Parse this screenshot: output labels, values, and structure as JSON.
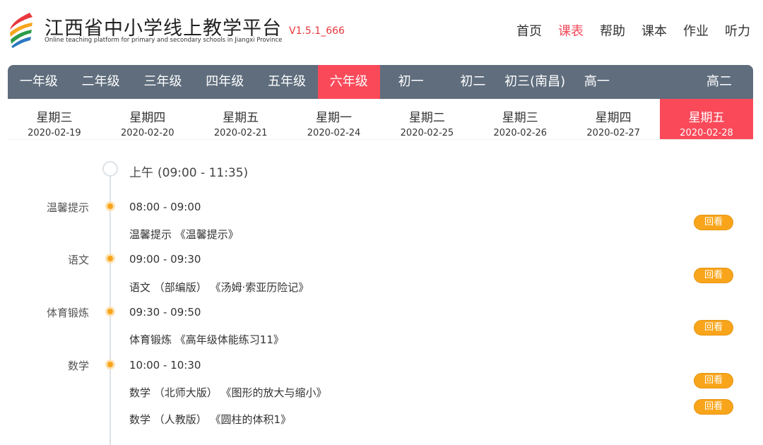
{
  "header": {
    "title": "江西省中小学线上教学平台",
    "subtitle": "Online teaching platform for primary and secondary schools in Jiangxi Province",
    "version": "V1.5.1_666",
    "nav": [
      "首页",
      "课表",
      "帮助",
      "课本",
      "作业",
      "听力"
    ],
    "active_nav": 1
  },
  "grades": [
    "一年级",
    "二年级",
    "三年级",
    "四年级",
    "五年级",
    "六年级",
    "初一",
    "初二",
    "初三(南昌)",
    "高一",
    "高二"
  ],
  "active_grade": 5,
  "days": [
    {
      "weekday": "星期三",
      "date": "2020-02-19"
    },
    {
      "weekday": "星期四",
      "date": "2020-02-20"
    },
    {
      "weekday": "星期五",
      "date": "2020-02-21"
    },
    {
      "weekday": "星期一",
      "date": "2020-02-24"
    },
    {
      "weekday": "星期二",
      "date": "2020-02-25"
    },
    {
      "weekday": "星期三",
      "date": "2020-02-26"
    },
    {
      "weekday": "星期四",
      "date": "2020-02-27"
    },
    {
      "weekday": "星期五",
      "date": "2020-02-28"
    }
  ],
  "active_day": 7,
  "section": {
    "label": "上午",
    "time": "(09:00 - 11:35)"
  },
  "replay_label": "回看",
  "schedule": [
    {
      "subject": "温馨提示",
      "time": "08:00 - 09:00",
      "courses": [
        "温馨提示 《温馨提示》"
      ]
    },
    {
      "subject": "语文",
      "time": "09:00 - 09:30",
      "courses": [
        "语文 （部编版） 《汤姆·索亚历险记》"
      ]
    },
    {
      "subject": "体育锻炼",
      "time": "09:30 - 09:50",
      "courses": [
        "体育锻炼 《高年级体能练习11》"
      ]
    },
    {
      "subject": "数学",
      "time": "10:00 - 10:30",
      "courses": [
        "数学 （北师大版） 《图形的放大与缩小》",
        "数学 （人教版） 《圆柱的体积1》"
      ]
    }
  ],
  "colors": {
    "accent": "#fa4a5a",
    "grade_bar": "#5f6d7d",
    "dot": "#f9a51b",
    "nav_active": "#f34b5b"
  }
}
